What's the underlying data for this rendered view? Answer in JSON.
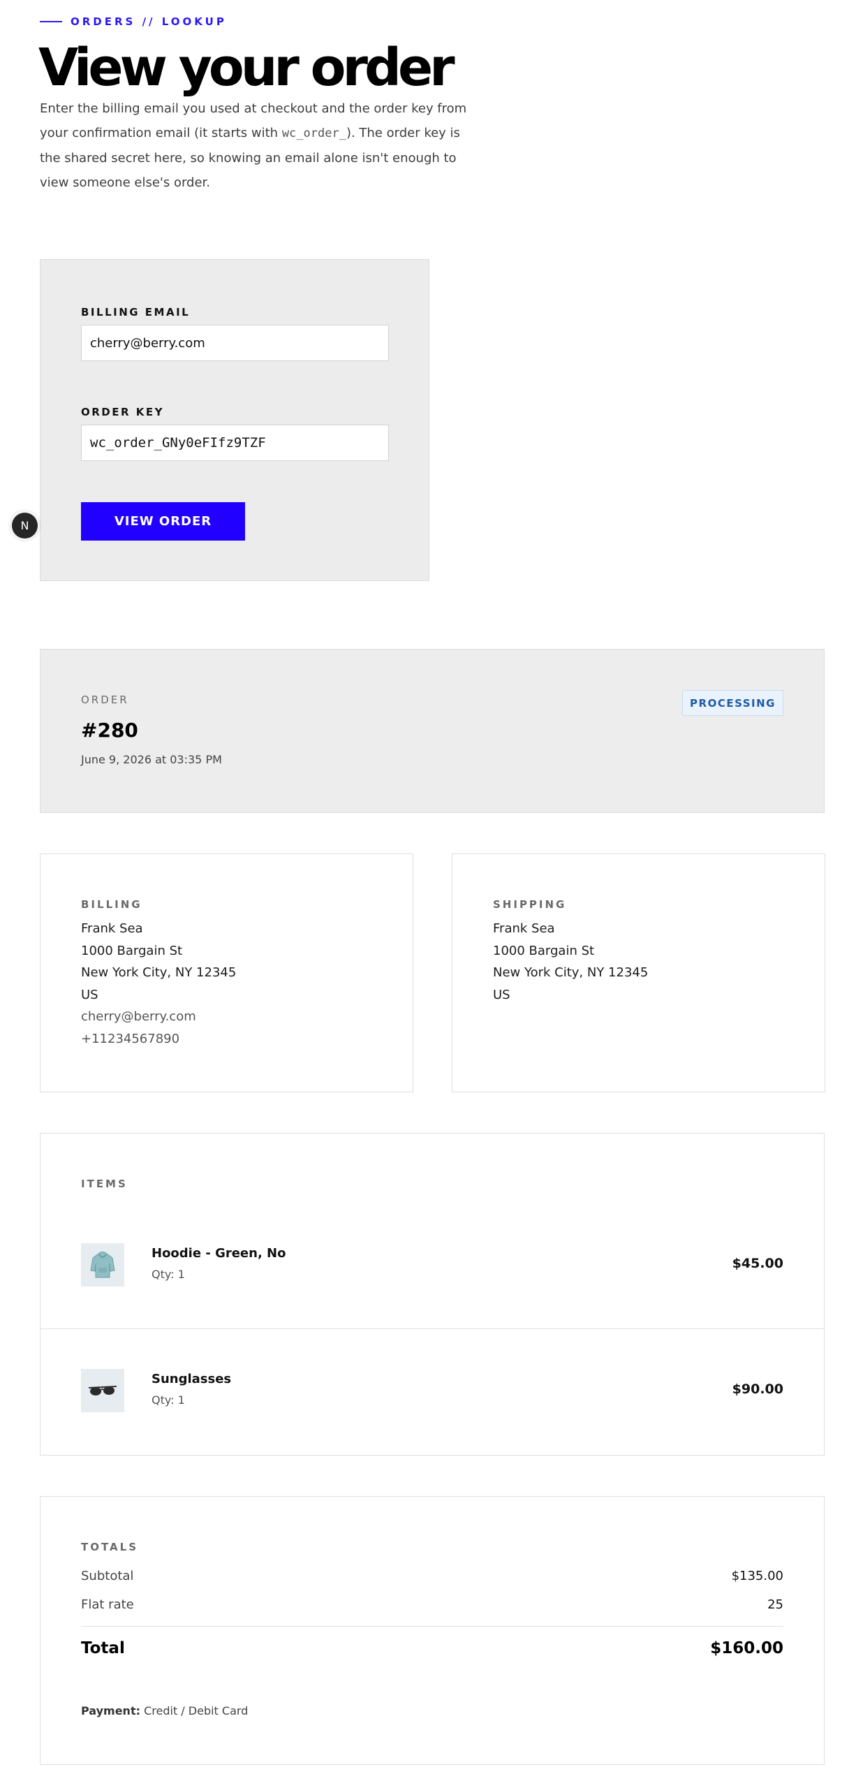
{
  "header": {
    "eyebrow": "ORDERS // LOOKUP",
    "title": "View your order",
    "intro_part1": "Enter the billing email you used at checkout and the order key from your confirmation email (it starts with ",
    "intro_code": "wc_order_",
    "intro_part2": "). The order key is the shared secret here, so knowing an email alone isn't enough to view someone else's order."
  },
  "lookup_form": {
    "email_label": "BILLING EMAIL",
    "email_value": "cherry@berry.com",
    "key_label": "ORDER KEY",
    "key_value": "wc_order_GNy0eFIfz9TZF",
    "submit_label": "VIEW ORDER"
  },
  "dev_badge": {
    "letter": "N"
  },
  "order": {
    "label": "ORDER",
    "number": "#280",
    "date": "June 9, 2026 at 03:35 PM",
    "status": "PROCESSING"
  },
  "billing": {
    "heading": "BILLING",
    "name": "Frank Sea",
    "street": "1000 Bargain St",
    "city": "New York City, NY 12345",
    "country": "US",
    "email": "cherry@berry.com",
    "phone": "+11234567890"
  },
  "shipping": {
    "heading": "SHIPPING",
    "name": "Frank Sea",
    "street": "1000 Bargain St",
    "city": "New York City, NY 12345",
    "country": "US"
  },
  "items": {
    "heading": "ITEMS",
    "list": [
      {
        "name": "Hoodie - Green, No",
        "qty": "Qty: 1",
        "price": "$45.00",
        "icon": "hoodie-icon"
      },
      {
        "name": "Sunglasses",
        "qty": "Qty: 1",
        "price": "$90.00",
        "icon": "sunglasses-icon"
      }
    ]
  },
  "totals": {
    "heading": "TOTALS",
    "subtotal_label": "Subtotal",
    "subtotal_value": "$135.00",
    "shipping_label": "Flat rate",
    "shipping_value": "25",
    "total_label": "Total",
    "total_value": "$160.00",
    "payment_label": "Payment:",
    "payment_value": "Credit / Debit Card"
  },
  "colors": {
    "accent": "#2200ff",
    "status_text": "#1f5aa6",
    "status_bg": "#eaf3fb"
  }
}
